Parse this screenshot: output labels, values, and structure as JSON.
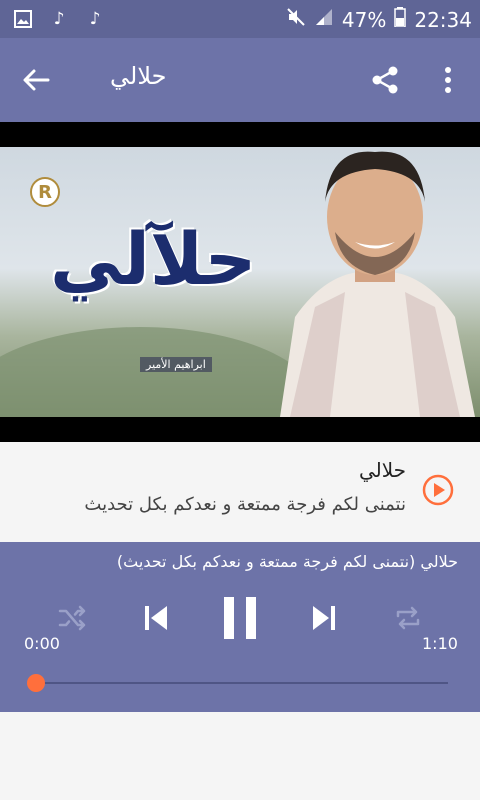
{
  "status_bar": {
    "battery": "47%",
    "time": "22:34",
    "icons": [
      "image-icon",
      "music-note-icon",
      "music-note-icon",
      "mute-icon",
      "signal-icon",
      "battery-icon"
    ]
  },
  "toolbar": {
    "title": "حلالي",
    "icons": [
      "back-arrow-icon",
      "share-icon",
      "more-vert-icon"
    ]
  },
  "video": {
    "art_title": "حلآلي",
    "art_brand": "R",
    "art_subtitle": "ابراهيم الأمير"
  },
  "track": {
    "title": "حلالي",
    "description": "نتمنى لكم فرجة ممتعة و نعدكم بكل تحديث"
  },
  "player": {
    "now_playing": "حلالي (نتمنى لكم فرجة ممتعة و نعدكم بكل تحديث)",
    "elapsed": "0:00",
    "duration": "1:10",
    "progress": 0.0,
    "accent_color": "#ff6f3c"
  }
}
